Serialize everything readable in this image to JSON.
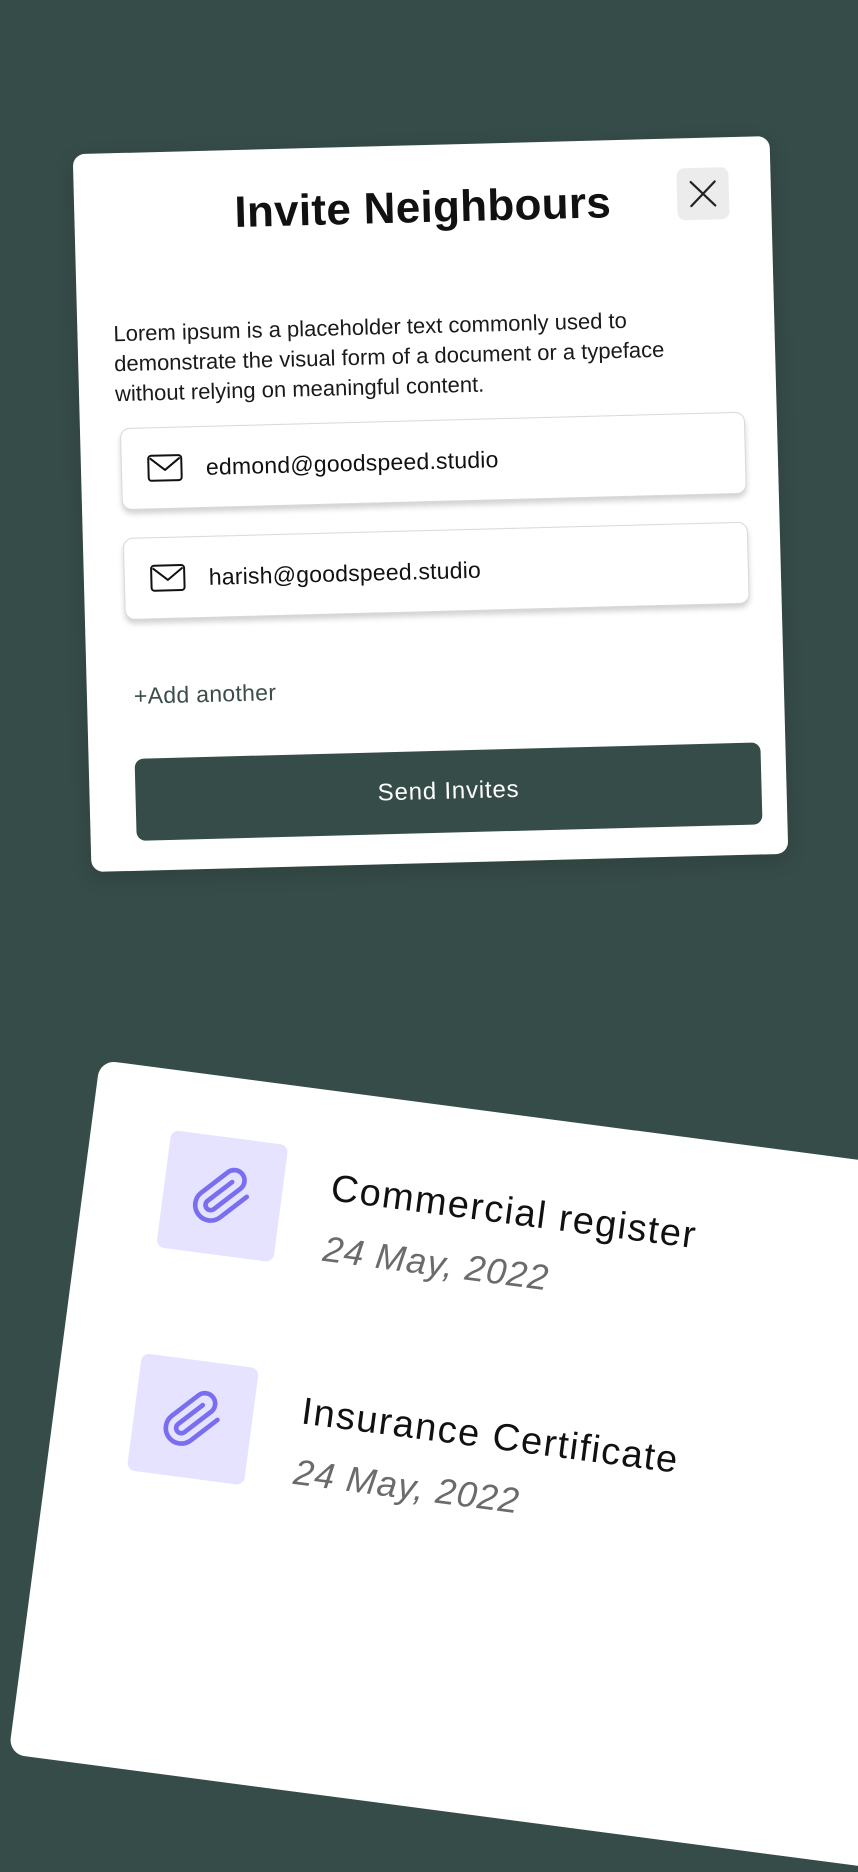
{
  "modal": {
    "title": "Invite Neighbours",
    "description": "Lorem ipsum is a placeholder text commonly used to demonstrate the visual form of a document or a typeface without relying on meaningful content.",
    "emails": [
      {
        "value": "edmond@goodspeed.studio",
        "icon": "mail-icon"
      },
      {
        "value": "harish@goodspeed.studio",
        "icon": "mail-icon"
      }
    ],
    "add_another_label": "+Add another",
    "send_label": "Send Invites",
    "close_icon": "close-icon"
  },
  "documents": [
    {
      "name": "Commercial register",
      "date": "24 May, 2022",
      "icon": "paperclip-icon"
    },
    {
      "name": "Insurance Certificate",
      "date": "24 May, 2022",
      "icon": "paperclip-icon"
    }
  ],
  "colors": {
    "background": "#364c48",
    "button": "#364c48",
    "attachment_bg": "#e5e3ff",
    "attachment_icon": "#7a6ef0"
  }
}
